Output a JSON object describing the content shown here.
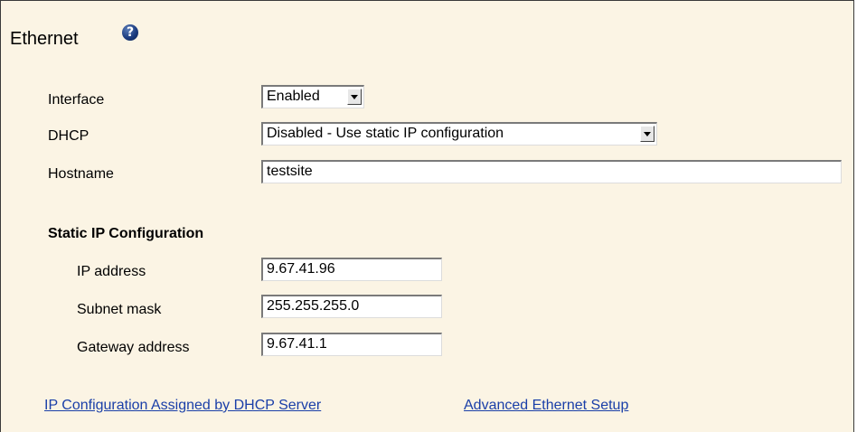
{
  "page": {
    "title": "Ethernet",
    "help_icon": "help-icon"
  },
  "form": {
    "interface_label": "Interface",
    "interface_value": "Enabled",
    "dhcp_label": "DHCP",
    "dhcp_value": "Disabled - Use static IP configuration",
    "hostname_label": "Hostname",
    "hostname_value": "testsite"
  },
  "static_ip": {
    "heading": "Static IP Configuration",
    "ip_label": "IP address",
    "ip_value": "9.67.41.96",
    "subnet_label": "Subnet mask",
    "subnet_value": "255.255.255.0",
    "gateway_label": "Gateway address",
    "gateway_value": "9.67.41.1"
  },
  "links": {
    "dhcp_assigned": "IP Configuration Assigned by DHCP Server",
    "advanced": "Advanced Ethernet Setup"
  },
  "colors": {
    "panel_bg": "#fbf4e4",
    "link": "#1a3fa8"
  }
}
